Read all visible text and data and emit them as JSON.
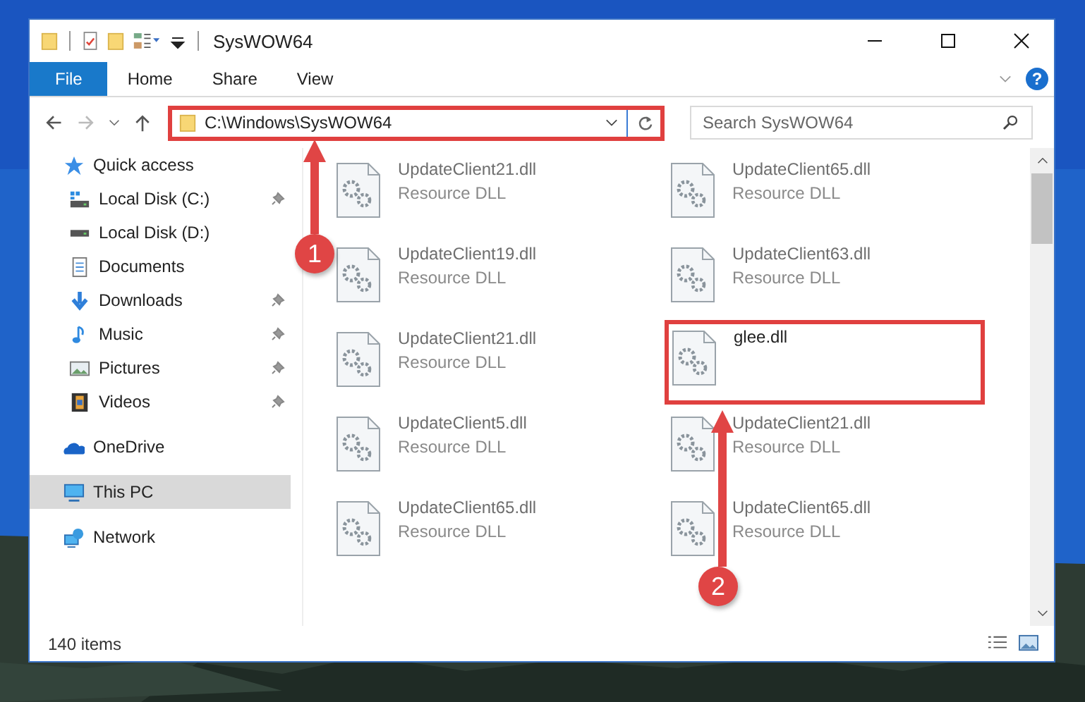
{
  "window": {
    "title": "SysWOW64"
  },
  "ribbon": {
    "tabs": [
      {
        "label": "File",
        "selected": true
      },
      {
        "label": "Home",
        "selected": false
      },
      {
        "label": "Share",
        "selected": false
      },
      {
        "label": "View",
        "selected": false
      }
    ],
    "help": "?"
  },
  "address": {
    "path": "C:\\Windows\\SysWOW64",
    "highlighted": true
  },
  "search": {
    "placeholder": "Search SysWOW64"
  },
  "sidebar": {
    "items": [
      {
        "label": "Quick access",
        "selected": false,
        "children": [
          {
            "label": "Local Disk (C:)",
            "selected": false,
            "pinned": true
          },
          {
            "label": "Local Disk (D:)",
            "selected": false,
            "pinned": false
          },
          {
            "label": "Documents",
            "selected": false,
            "pinned": false
          },
          {
            "label": "Downloads",
            "selected": false,
            "pinned": true
          },
          {
            "label": "Music",
            "selected": false,
            "pinned": true
          },
          {
            "label": "Pictures",
            "selected": false,
            "pinned": true
          },
          {
            "label": "Videos",
            "selected": false,
            "pinned": true
          }
        ]
      },
      {
        "label": "OneDrive",
        "selected": false
      },
      {
        "label": "This PC",
        "selected": true
      },
      {
        "label": "Network",
        "selected": false
      }
    ]
  },
  "files": [
    {
      "name": "UpdateClient21.dll",
      "type": "Resource DLL",
      "dimmed": true,
      "highlighted": false
    },
    {
      "name": "UpdateClient65.dll",
      "type": "Resource DLL",
      "dimmed": true,
      "highlighted": false
    },
    {
      "name": "UpdateClient19.dll",
      "type": "Resource DLL",
      "dimmed": true,
      "highlighted": false
    },
    {
      "name": "UpdateClient63.dll",
      "type": "Resource DLL",
      "dimmed": true,
      "highlighted": false
    },
    {
      "name": "UpdateClient21.dll",
      "type": "Resource DLL",
      "dimmed": true,
      "highlighted": false
    },
    {
      "name": "glee.dll",
      "dimmed": false,
      "highlighted": true
    },
    {
      "name": "UpdateClient5.dll",
      "type": "Resource DLL",
      "dimmed": true,
      "highlighted": false
    },
    {
      "name": "UpdateClient21.dll",
      "type": "Resource DLL",
      "dimmed": true,
      "highlighted": false
    },
    {
      "name": "UpdateClient65.dll",
      "type": "Resource DLL",
      "dimmed": true,
      "highlighted": false
    },
    {
      "name": "UpdateClient65.dll",
      "type": "Resource DLL",
      "dimmed": true,
      "highlighted": false
    }
  ],
  "status_bar": {
    "item_count": "140 items"
  },
  "annotations": [
    {
      "number": "1"
    },
    {
      "number": "2"
    }
  ]
}
